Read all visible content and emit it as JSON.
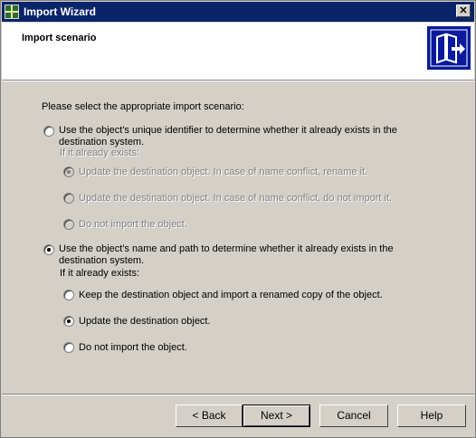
{
  "window": {
    "title": "Import Wizard",
    "close_glyph": "✕"
  },
  "header": {
    "title": "Import scenario"
  },
  "prompt": "Please select the appropriate import scenario:",
  "option1": {
    "label_line1": "Use the object's unique identifier to determine whether it already exists in the",
    "label_line2": "destination system.",
    "if_exists": "If it already exists:",
    "suboptions": [
      "Update the destination object. In case of name conflict, rename it.",
      "Update the destination object. In case of name conflict, do not import it.",
      "Do not import the object."
    ]
  },
  "option2": {
    "label_line1": "Use the object's name and path to determine whether it already exists in the",
    "label_line2": "destination system.",
    "if_exists": "If it already exists:",
    "suboptions": [
      "Keep the destination object and import a renamed copy of the object.",
      "Update the destination object.",
      "Do not import the object."
    ]
  },
  "buttons": {
    "back": "< Back",
    "next": "Next >",
    "cancel": "Cancel",
    "help": "Help"
  },
  "colors": {
    "titlebar": "#0a246a",
    "dialog": "#d4d0c8",
    "header_graphic": "#0a1a9a"
  }
}
